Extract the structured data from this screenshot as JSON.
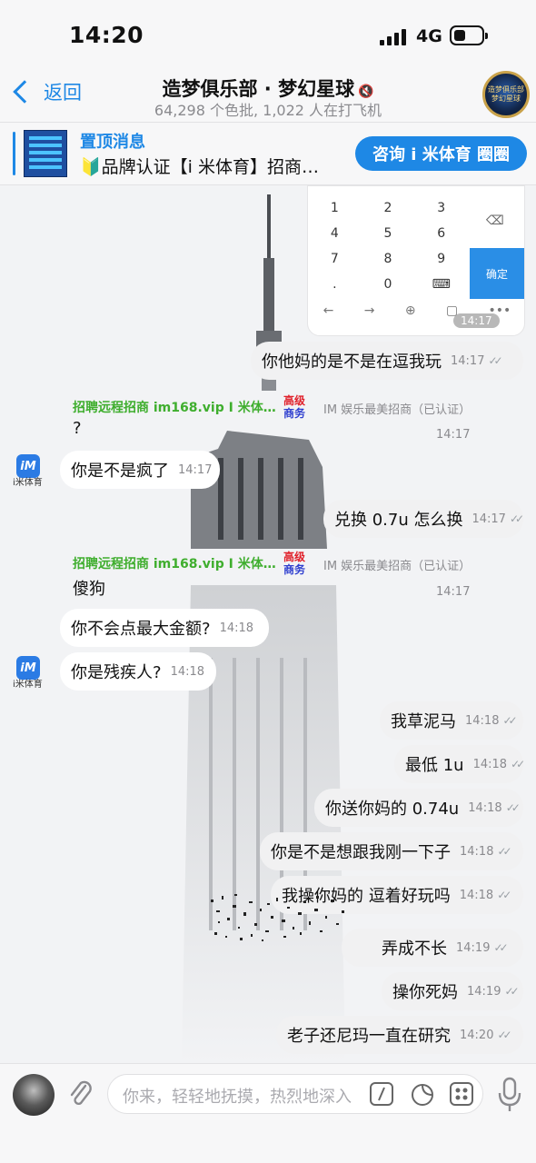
{
  "status_bar": {
    "time": "14:20",
    "network": "4G"
  },
  "header": {
    "back_label": "返回",
    "title": "造梦俱乐部 · 梦幻星球",
    "subtitle": "64,298 个色批, 1,022 人在打飞机",
    "avatar_text": "造梦俱乐部 梦幻星球"
  },
  "pinned": {
    "title": "置顶消息",
    "text": "🔰品牌认证【i 米体育】招商…",
    "button_label": "咨询 i 米体育 圈圈"
  },
  "keypad_image": {
    "rows": [
      [
        "1",
        "2",
        "3"
      ],
      [
        "4",
        "5",
        "6"
      ],
      [
        "7",
        "8",
        "9"
      ],
      [
        ".",
        "0",
        "⌨"
      ]
    ],
    "confirm_label": "确定",
    "time": "14:17"
  },
  "messages": {
    "m1": {
      "text": "你他妈的是不是在逗我玩",
      "time": "14:17"
    },
    "g1": {
      "sender": "招聘远程招商 im168.vip I 米体…",
      "rank_top": "高级",
      "rank_bottom": "商务",
      "cert": "IM 娱乐最美招商（已认证）",
      "text": "?",
      "time": "14:17"
    },
    "i1": {
      "text": "你是不是疯了",
      "time": "14:17"
    },
    "avatar_label": "i米体育",
    "avatar_mark": "iM",
    "m2": {
      "text": "兑换 0.7u 怎么换",
      "time": "14:17"
    },
    "g2": {
      "sender": "招聘远程招商 im168.vip I 米体…",
      "rank_top": "高级",
      "rank_bottom": "商务",
      "cert": "IM 娱乐最美招商（已认证）",
      "text": "傻狗",
      "time": "14:17"
    },
    "i2": {
      "text": "你不会点最大金额?",
      "time": "14:18"
    },
    "i3": {
      "text": "你是残疾人?",
      "time": "14:18"
    },
    "m3": {
      "text": "我草泥马",
      "time": "14:18"
    },
    "m4": {
      "text": "最低 1u",
      "time": "14:18"
    },
    "m5": {
      "text": "你送你妈的 0.74u",
      "time": "14:18"
    },
    "m6": {
      "text": "你是不是想跟我刚一下子",
      "time": "14:18"
    },
    "m7": {
      "text": "我操你妈的 逗着好玩吗",
      "time": "14:18"
    },
    "m8": {
      "text": "弄成不长",
      "time": "14:19"
    },
    "m9": {
      "text": "操你死妈",
      "time": "14:19"
    },
    "m10": {
      "text": "老子还尼玛一直在研究",
      "time": "14:20"
    }
  },
  "composer": {
    "placeholder": "你来，轻轻地抚摸，热烈地深入"
  },
  "colors": {
    "accent": "#1e88e5",
    "sender_green": "#3fae2e",
    "rank_red": "#e0202a",
    "rank_blue": "#2f3fcf"
  }
}
